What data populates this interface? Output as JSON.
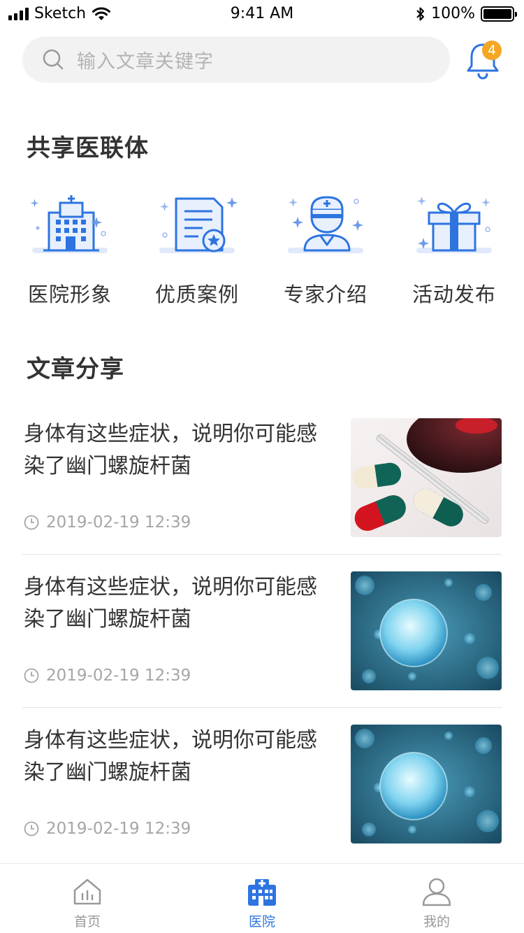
{
  "status_bar": {
    "carrier": "Sketch",
    "time": "9:41 AM",
    "battery": "100%"
  },
  "search": {
    "placeholder": "输入文章关键字"
  },
  "notifications": {
    "badge_count": "4"
  },
  "consortium": {
    "title": "共享医联体",
    "items": [
      {
        "label": "医院形象",
        "icon": "hospital-building-icon"
      },
      {
        "label": "优质案例",
        "icon": "document-star-icon"
      },
      {
        "label": "专家介绍",
        "icon": "doctor-icon"
      },
      {
        "label": "活动发布",
        "icon": "gift-icon"
      }
    ]
  },
  "articles": {
    "title": "文章分享",
    "items": [
      {
        "title": "身体有这些症状，说明你可能感染了幽门螺旋杆菌",
        "time": "2019-02-19 12:39",
        "image": "pills-thermometer"
      },
      {
        "title": "身体有这些症状，说明你可能感染了幽门螺旋杆菌",
        "time": "2019-02-19 12:39",
        "image": "bacteria-cell"
      },
      {
        "title": "身体有这些症状，说明你可能感染了幽门螺旋杆菌",
        "time": "2019-02-19 12:39",
        "image": "bacteria-cell"
      }
    ]
  },
  "tabbar": {
    "items": [
      {
        "label": "首页",
        "icon": "home-chart-icon"
      },
      {
        "label": "医院",
        "icon": "hospital-icon"
      },
      {
        "label": "我的",
        "icon": "person-icon"
      }
    ],
    "active": "医院"
  },
  "colors": {
    "accent": "#2d74e0",
    "badge": "#f5a623",
    "search_bg": "#f2f2f2"
  }
}
